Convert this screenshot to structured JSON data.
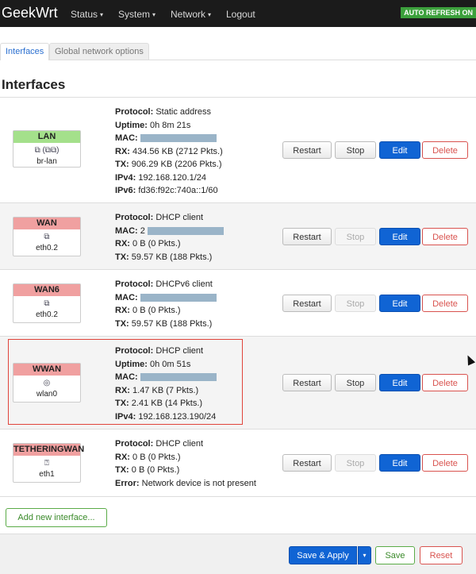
{
  "header": {
    "brand": "GeekWrt",
    "nav": [
      {
        "label": "Status",
        "caret": "▾"
      },
      {
        "label": "System",
        "caret": "▾"
      },
      {
        "label": "Network",
        "caret": "▾"
      },
      {
        "label": "Logout"
      }
    ],
    "auto_refresh": "AUTO REFRESH ON"
  },
  "tabs": [
    {
      "label": "Interfaces",
      "active": true
    },
    {
      "label": "Global network options",
      "active": false
    }
  ],
  "page_title": "Interfaces",
  "colors": {
    "green_badge": "#a4e08b",
    "red_badge": "#f0a0a0",
    "primary": "#1064d4",
    "danger": "#d9534f",
    "success": "#5aab47"
  },
  "interfaces": [
    {
      "name": "LAN",
      "color": "green",
      "icon": "bridge-icon",
      "icon_glyph": "⧉ (⧉⧉)",
      "device": "br-lan",
      "info": [
        {
          "label": "Protocol:",
          "value": "Static address"
        },
        {
          "label": "Uptime:",
          "value": "0h 8m 21s"
        },
        {
          "label": "MAC:",
          "value": "",
          "redacted": true
        },
        {
          "label": "RX:",
          "value": "434.56 KB (2712 Pkts.)"
        },
        {
          "label": "TX:",
          "value": "906.29 KB (2206 Pkts.)"
        },
        {
          "label": "IPv4:",
          "value": "192.168.120.1/24"
        },
        {
          "label": "IPv6:",
          "value": "fd36:f92c:740a::1/60"
        }
      ],
      "buttons": {
        "restart": "Restart",
        "stop": "Stop",
        "edit": "Edit",
        "delete": "Delete"
      },
      "stop_enabled": true
    },
    {
      "name": "WAN",
      "color": "red",
      "icon": "ethernet-port-icon",
      "icon_glyph": "⧉",
      "device": "eth0.2",
      "info": [
        {
          "label": "Protocol:",
          "value": "DHCP client"
        },
        {
          "label": "MAC:",
          "value": "2",
          "redacted": true
        },
        {
          "label": "RX:",
          "value": "0 B (0 Pkts.)"
        },
        {
          "label": "TX:",
          "value": "59.57 KB (188 Pkts.)"
        }
      ],
      "buttons": {
        "restart": "Restart",
        "stop": "Stop",
        "edit": "Edit",
        "delete": "Delete"
      },
      "stop_enabled": false
    },
    {
      "name": "WAN6",
      "color": "red",
      "icon": "ethernet-port-icon",
      "icon_glyph": "⧉",
      "device": "eth0.2",
      "info": [
        {
          "label": "Protocol:",
          "value": "DHCPv6 client"
        },
        {
          "label": "MAC:",
          "value": "",
          "redacted": true
        },
        {
          "label": "RX:",
          "value": "0 B (0 Pkts.)"
        },
        {
          "label": "TX:",
          "value": "59.57 KB (188 Pkts.)"
        }
      ],
      "buttons": {
        "restart": "Restart",
        "stop": "Stop",
        "edit": "Edit",
        "delete": "Delete"
      },
      "stop_enabled": false
    },
    {
      "name": "WWAN",
      "color": "red",
      "icon": "wireless-icon",
      "icon_glyph": "◎",
      "device": "wlan0",
      "info": [
        {
          "label": "Protocol:",
          "value": "DHCP client"
        },
        {
          "label": "Uptime:",
          "value": "0h 0m 51s"
        },
        {
          "label": "MAC:",
          "value": "",
          "redacted": true
        },
        {
          "label": "RX:",
          "value": "1.47 KB (7 Pkts.)"
        },
        {
          "label": "TX:",
          "value": "2.41 KB (14 Pkts.)"
        },
        {
          "label": "IPv4:",
          "value": "192.168.123.190/24"
        }
      ],
      "buttons": {
        "restart": "Restart",
        "stop": "Stop",
        "edit": "Edit",
        "delete": "Delete"
      },
      "stop_enabled": true
    },
    {
      "name": "TETHERINGWAN",
      "color": "red",
      "icon": "missing-device-icon",
      "icon_glyph": "⍰",
      "device": "eth1",
      "info": [
        {
          "label": "Protocol:",
          "value": "DHCP client"
        },
        {
          "label": "RX:",
          "value": "0 B (0 Pkts.)"
        },
        {
          "label": "TX:",
          "value": "0 B (0 Pkts.)"
        },
        {
          "label": "Error:",
          "value": "Network device is not present"
        }
      ],
      "buttons": {
        "restart": "Restart",
        "stop": "Stop",
        "edit": "Edit",
        "delete": "Delete"
      },
      "stop_enabled": false
    }
  ],
  "add_interface": "Add new interface...",
  "footer": {
    "save_apply": "Save & Apply",
    "save_apply_caret": "▾",
    "save": "Save",
    "reset": "Reset"
  }
}
